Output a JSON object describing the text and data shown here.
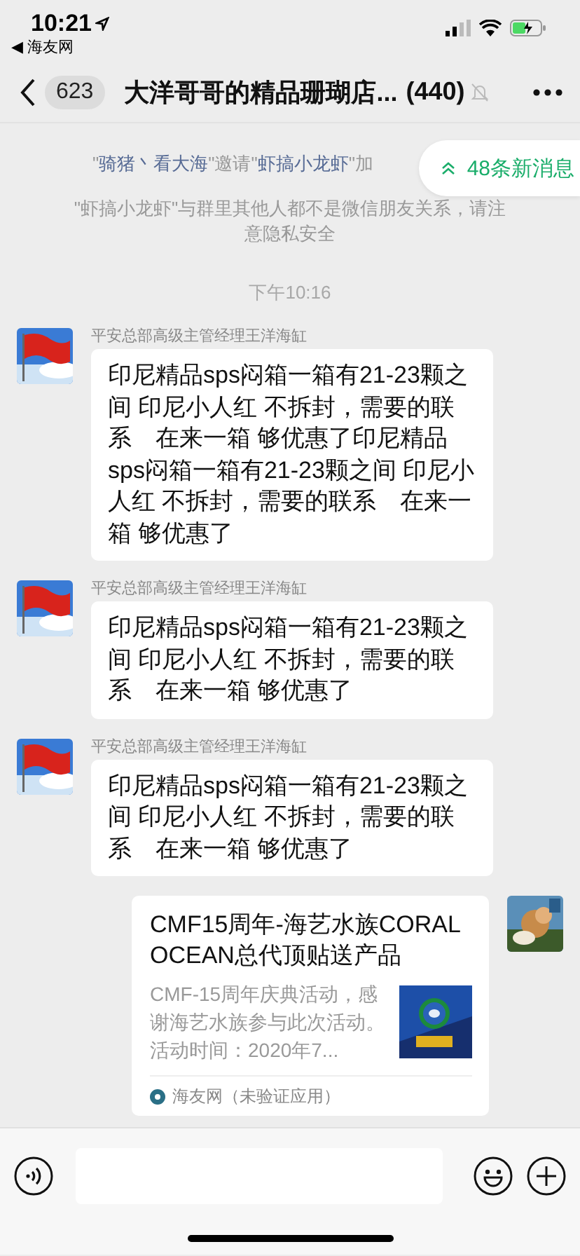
{
  "status_bar": {
    "time": "10:21",
    "back_app": {
      "arrow": "◀",
      "label": "海友网"
    },
    "battery_charging": true
  },
  "nav": {
    "unread": "623",
    "title": "大洋哥哥的精品珊瑚店...",
    "member_count": "(440)",
    "muted": true
  },
  "new_messages_pill": {
    "label": "48条新消息"
  },
  "messages": [
    {
      "kind": "notice",
      "parts": [
        {
          "kind": "plain",
          "text": "\""
        },
        {
          "kind": "name",
          "text": "骑猪丶看大海"
        },
        {
          "kind": "plain",
          "text": "\"邀请\""
        },
        {
          "kind": "name",
          "text": "虾搞小龙虾"
        },
        {
          "kind": "plain",
          "text": "\"加"
        }
      ]
    },
    {
      "kind": "notice",
      "parts": [
        {
          "kind": "plain",
          "text": "\"虾搞小龙虾\"与群里其他人都不是微信朋友关系，请注意隐私安全"
        }
      ]
    },
    {
      "kind": "time",
      "text": "下午10:16"
    },
    {
      "kind": "text",
      "sender": "平安总部高级主管经理王洋海缸",
      "text": "印尼精品sps闷箱一箱有21-23颗之间 印尼小人红 不拆封，需要的联系　在来一箱 够优惠了印尼精品sps闷箱一箱有21-23颗之间 印尼小人红 不拆封，需要的联系　在来一箱 够优惠了"
    },
    {
      "kind": "text",
      "sender": "平安总部高级主管经理王洋海缸",
      "text": "印尼精品sps闷箱一箱有21-23颗之间 印尼小人红 不拆封，需要的联系　在来一箱 够优惠了"
    },
    {
      "kind": "text",
      "sender": "平安总部高级主管经理王洋海缸",
      "text": "印尼精品sps闷箱一箱有21-23颗之间 印尼小人红 不拆封，需要的联系　在来一箱 够优惠了"
    },
    {
      "kind": "link_card",
      "title": "CMF15周年-海艺水族CORAL OCEAN总代顶贴送产品",
      "description": "CMF-15周年庆典活动，感谢海艺水族参与此次活动。活动时间：2020年7...",
      "source": "海友网（未验证应用）"
    }
  ]
}
